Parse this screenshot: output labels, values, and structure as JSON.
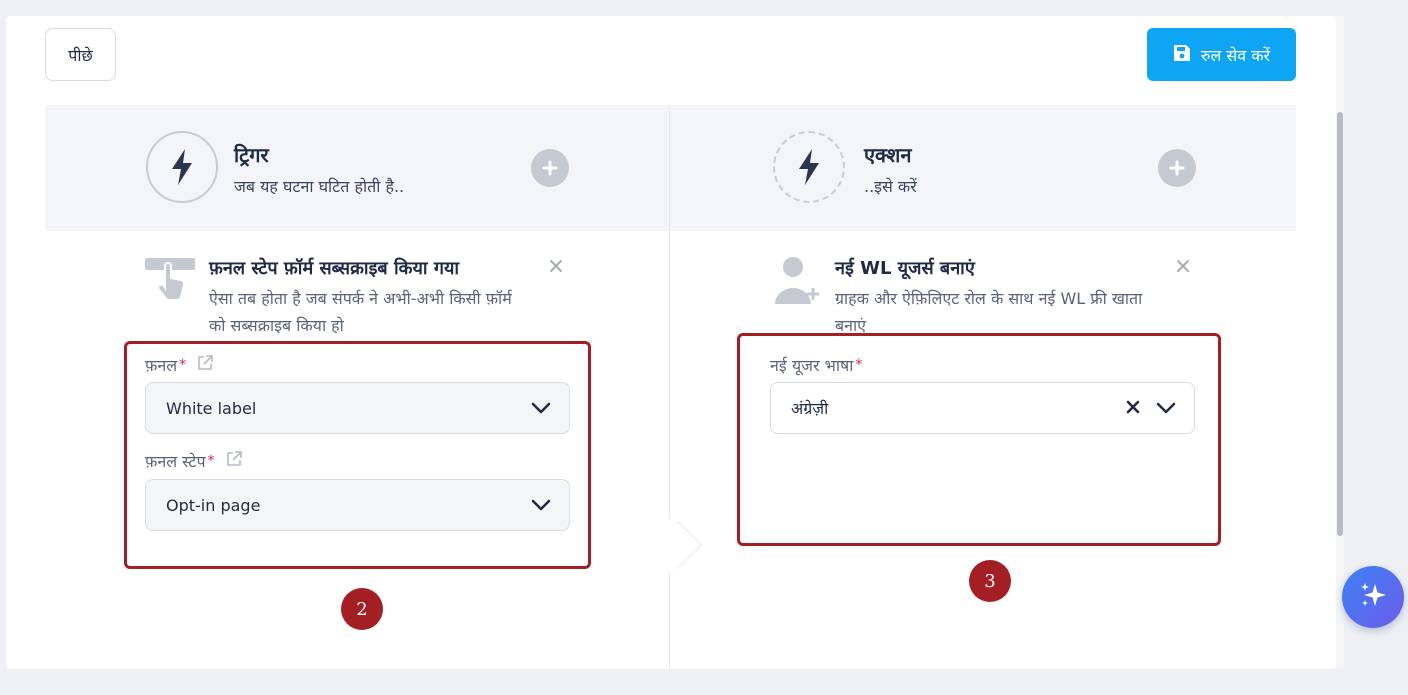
{
  "toolbar": {
    "back_label": "पीछे",
    "save_label": "रुल सेव करें"
  },
  "trigger": {
    "title": "ट्रिगर",
    "subtitle": "जब यह घटना घटित होती है..",
    "item": {
      "title": "फ़नल स्टेप फ़ॉर्म सब्सक्राइब किया गया",
      "description": "ऐसा तब होता है जब संपर्क ने अभी-अभी किसी फ़ॉर्म को सब्सक्राइब किया हो"
    },
    "fields": [
      {
        "label": "फ़नल",
        "value": "White label"
      },
      {
        "label": "फ़नल स्टेप",
        "value": "Opt-in page"
      }
    ]
  },
  "action": {
    "title": "एक्शन",
    "subtitle": "..इसे करें",
    "item": {
      "title": "नई WL यूजर्स बनाएं",
      "description": "ग्राहक और ऐफ़िलिएट रोल के साथ नई WL फ्री खाता बनाएं"
    },
    "fields": [
      {
        "label": "नई यूजर भाषा",
        "value": "अंग्रेज़ी"
      }
    ]
  },
  "annotations": {
    "left_number": "2",
    "right_number": "3"
  },
  "required_mark": "*",
  "icons": [
    "save-icon",
    "bolt-icon",
    "plus-icon",
    "pointer-hand-icon",
    "user-add-icon",
    "close-icon",
    "external-link-icon",
    "chevron-down-icon",
    "clear-icon",
    "sparkle-icon"
  ],
  "colors": {
    "primary": "#0ea5f5",
    "annotation": "#a31f24",
    "required": "#e11d48"
  }
}
